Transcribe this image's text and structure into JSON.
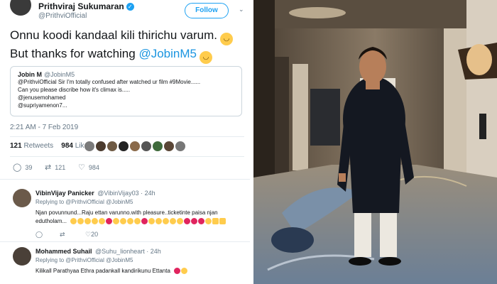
{
  "tweet": {
    "author_name": "Prithviraj Sukumaran",
    "author_handle": "@PrithviOfficial",
    "follow_label": "Follow",
    "text_line1": "Onnu koodi kandaal kili thirichu varum.",
    "text_line2_prefix": "But thanks for watching",
    "text_mention": "@JobinM5",
    "quote": {
      "name": "Jobin M",
      "handle": "@JobinM5",
      "line1": "@PrithviOfficial Sir I'm totally confused after watched ur film #9Movie......",
      "line2": "Can you please discribe how it's climax is.....",
      "line3": "@jenusemohamed",
      "line4": "@supriyamenon7..."
    },
    "timestamp": "2:21 AM - 7 Feb 2019",
    "retweets_count": "121",
    "retweets_label": "Retweets",
    "likes_count": "984",
    "likes_label": "Likes",
    "actions": {
      "replies": "39",
      "retweets": "121",
      "likes": "984"
    }
  },
  "replies": [
    {
      "name": "VibinVijay Panicker",
      "handle": "@VibinVijay03 · 24h",
      "replying_to": "Replying to @PrithviOfficial @JobinM5",
      "text_line1": "Njan povunnund...Raju ettan varunno.with pleasure..ticketinte paisa njan",
      "text_line2": "edutholam...",
      "likes": "20"
    },
    {
      "name": "Mohammed Suhail",
      "handle": "@Suhu_lionheart · 24h",
      "replying_to": "Replying to @PrithviOfficial @JobinM5",
      "text_line1": "Kilikall Parathyaa Ethra padankall kandirikunu Ettanta"
    }
  ],
  "icons": [
    "verified-icon",
    "chevron-down-icon",
    "reply-icon",
    "retweet-icon",
    "like-icon"
  ],
  "colors": {
    "twitter_blue": "#1da1f2",
    "mention_blue": "#1b95e0",
    "muted_gray": "#657786"
  }
}
